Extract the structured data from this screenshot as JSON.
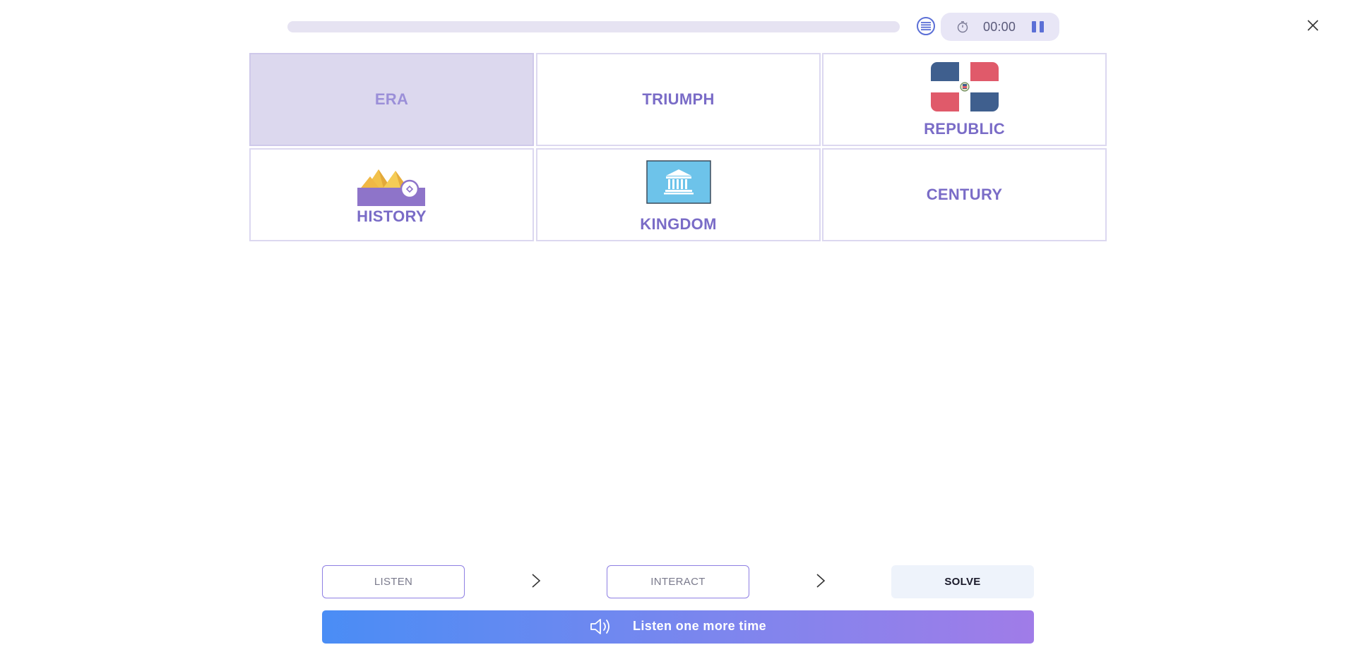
{
  "header": {
    "progress": 0.0,
    "timer": "00:00"
  },
  "cards": [
    {
      "label": "ERA",
      "selected": true,
      "icon": "none"
    },
    {
      "label": "TRIUMPH",
      "selected": false,
      "icon": "none"
    },
    {
      "label": "REPUBLIC",
      "selected": false,
      "icon": "dominican-republic-flag-icon"
    },
    {
      "label": "HISTORY",
      "selected": false,
      "icon": "pyramids-icon"
    },
    {
      "label": "KINGDOM",
      "selected": false,
      "icon": "unesco-flag-icon"
    },
    {
      "label": "CENTURY",
      "selected": false,
      "icon": "none"
    }
  ],
  "steps": {
    "listen": "LISTEN",
    "interact": "INTERACT",
    "solve": "SOLVE"
  },
  "footer": {
    "listen_again_label": "Listen one more time"
  },
  "colors": {
    "accent": "#7a6cc7",
    "selected_bg": "#dcd8ee",
    "gradient_start": "#4a8df5",
    "gradient_end": "#a07ce8"
  }
}
